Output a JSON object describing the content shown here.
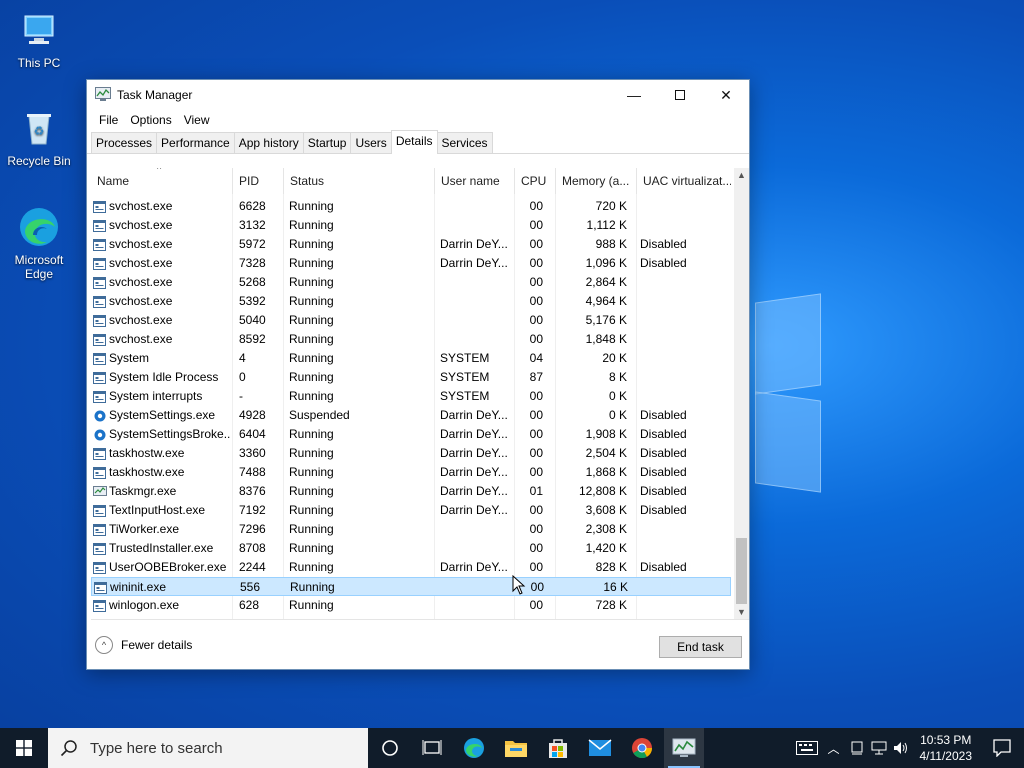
{
  "desktop": {
    "icons": [
      {
        "label": "This PC"
      },
      {
        "label": "Recycle Bin"
      },
      {
        "label": "Microsoft Edge"
      }
    ]
  },
  "window": {
    "title": "Task Manager",
    "menu": [
      "File",
      "Options",
      "View"
    ],
    "tabs": [
      "Processes",
      "Performance",
      "App history",
      "Startup",
      "Users",
      "Details",
      "Services"
    ],
    "active_tab": "Details",
    "columns": [
      "Name",
      "PID",
      "Status",
      "User name",
      "CPU",
      "Memory (a...",
      "UAC virtualizat..."
    ],
    "rows": [
      {
        "name": "svchost.exe",
        "pid": "6628",
        "status": "Running",
        "user": "",
        "cpu": "00",
        "mem": "720 K",
        "uac": "",
        "icon": "service-icon"
      },
      {
        "name": "svchost.exe",
        "pid": "3132",
        "status": "Running",
        "user": "",
        "cpu": "00",
        "mem": "1,112 K",
        "uac": "",
        "icon": "service-icon"
      },
      {
        "name": "svchost.exe",
        "pid": "5972",
        "status": "Running",
        "user": "Darrin DeY...",
        "cpu": "00",
        "mem": "988 K",
        "uac": "Disabled",
        "icon": "service-icon"
      },
      {
        "name": "svchost.exe",
        "pid": "7328",
        "status": "Running",
        "user": "Darrin DeY...",
        "cpu": "00",
        "mem": "1,096 K",
        "uac": "Disabled",
        "icon": "service-icon"
      },
      {
        "name": "svchost.exe",
        "pid": "5268",
        "status": "Running",
        "user": "",
        "cpu": "00",
        "mem": "2,864 K",
        "uac": "",
        "icon": "service-icon"
      },
      {
        "name": "svchost.exe",
        "pid": "5392",
        "status": "Running",
        "user": "",
        "cpu": "00",
        "mem": "4,964 K",
        "uac": "",
        "icon": "service-icon"
      },
      {
        "name": "svchost.exe",
        "pid": "5040",
        "status": "Running",
        "user": "",
        "cpu": "00",
        "mem": "5,176 K",
        "uac": "",
        "icon": "service-icon"
      },
      {
        "name": "svchost.exe",
        "pid": "8592",
        "status": "Running",
        "user": "",
        "cpu": "00",
        "mem": "1,848 K",
        "uac": "",
        "icon": "service-icon"
      },
      {
        "name": "System",
        "pid": "4",
        "status": "Running",
        "user": "SYSTEM",
        "cpu": "04",
        "mem": "20 K",
        "uac": "",
        "icon": "process-icon"
      },
      {
        "name": "System Idle Process",
        "pid": "0",
        "status": "Running",
        "user": "SYSTEM",
        "cpu": "87",
        "mem": "8 K",
        "uac": "",
        "icon": "process-icon"
      },
      {
        "name": "System interrupts",
        "pid": "-",
        "status": "Running",
        "user": "SYSTEM",
        "cpu": "00",
        "mem": "0 K",
        "uac": "",
        "icon": "process-icon"
      },
      {
        "name": "SystemSettings.exe",
        "pid": "4928",
        "status": "Suspended",
        "user": "Darrin DeY...",
        "cpu": "00",
        "mem": "0 K",
        "uac": "Disabled",
        "icon": "gear-icon"
      },
      {
        "name": "SystemSettingsBroke...",
        "pid": "6404",
        "status": "Running",
        "user": "Darrin DeY...",
        "cpu": "00",
        "mem": "1,908 K",
        "uac": "Disabled",
        "icon": "gear-icon"
      },
      {
        "name": "taskhostw.exe",
        "pid": "3360",
        "status": "Running",
        "user": "Darrin DeY...",
        "cpu": "00",
        "mem": "2,504 K",
        "uac": "Disabled",
        "icon": "process-icon"
      },
      {
        "name": "taskhostw.exe",
        "pid": "7488",
        "status": "Running",
        "user": "Darrin DeY...",
        "cpu": "00",
        "mem": "1,868 K",
        "uac": "Disabled",
        "icon": "process-icon"
      },
      {
        "name": "Taskmgr.exe",
        "pid": "8376",
        "status": "Running",
        "user": "Darrin DeY...",
        "cpu": "01",
        "mem": "12,808 K",
        "uac": "Disabled",
        "icon": "taskmgr-icon"
      },
      {
        "name": "TextInputHost.exe",
        "pid": "7192",
        "status": "Running",
        "user": "Darrin DeY...",
        "cpu": "00",
        "mem": "3,608 K",
        "uac": "Disabled",
        "icon": "process-icon"
      },
      {
        "name": "TiWorker.exe",
        "pid": "7296",
        "status": "Running",
        "user": "",
        "cpu": "00",
        "mem": "2,308 K",
        "uac": "",
        "icon": "process-icon"
      },
      {
        "name": "TrustedInstaller.exe",
        "pid": "8708",
        "status": "Running",
        "user": "",
        "cpu": "00",
        "mem": "1,420 K",
        "uac": "",
        "icon": "process-icon"
      },
      {
        "name": "UserOOBEBroker.exe",
        "pid": "2244",
        "status": "Running",
        "user": "Darrin DeY...",
        "cpu": "00",
        "mem": "828 K",
        "uac": "Disabled",
        "icon": "process-icon"
      },
      {
        "name": "wininit.exe",
        "pid": "556",
        "status": "Running",
        "user": "",
        "cpu": "00",
        "mem": "16 K",
        "uac": "",
        "icon": "process-icon",
        "selected": true
      },
      {
        "name": "winlogon.exe",
        "pid": "628",
        "status": "Running",
        "user": "",
        "cpu": "00",
        "mem": "728 K",
        "uac": "",
        "icon": "process-icon"
      }
    ],
    "footer": {
      "fewer_details": "Fewer details",
      "end_task": "End task"
    }
  },
  "taskbar": {
    "search_placeholder": "Type here to search",
    "clock_time": "10:53 PM",
    "clock_date": "4/11/2023"
  },
  "colors": {
    "accent": "#0078d7",
    "selection": "#cce8ff",
    "taskbar": "#101c2a"
  }
}
